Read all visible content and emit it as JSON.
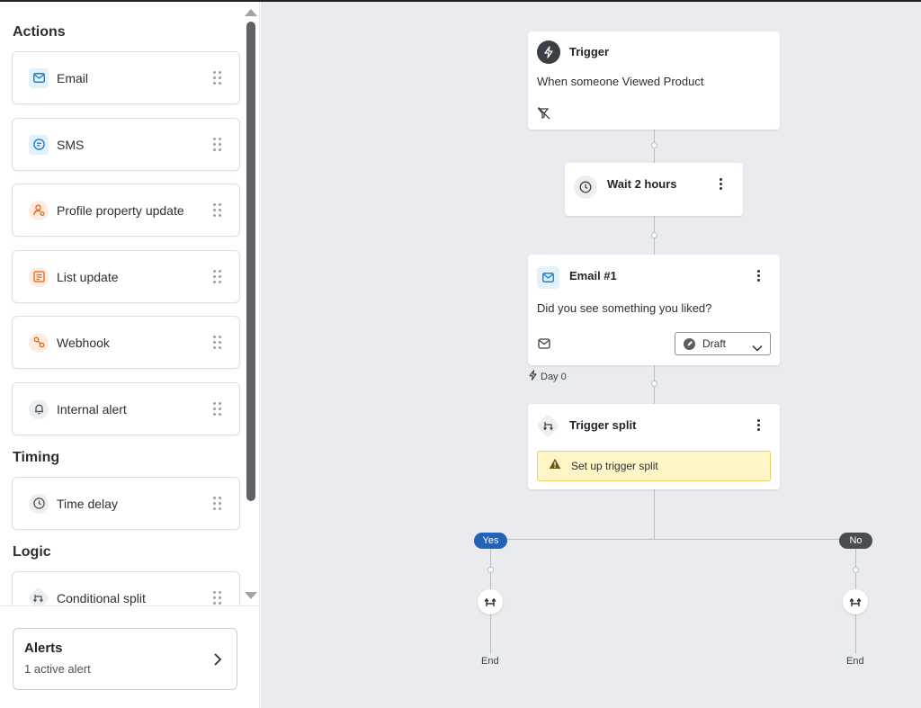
{
  "sidebar": {
    "sections": {
      "actions": "Actions",
      "timing": "Timing",
      "logic": "Logic"
    },
    "items": [
      {
        "label": "Email",
        "icon": "envelope-icon"
      },
      {
        "label": "SMS",
        "icon": "sms-icon"
      },
      {
        "label": "Profile property update",
        "icon": "profile-edit-icon"
      },
      {
        "label": "List update",
        "icon": "list-icon"
      },
      {
        "label": "Webhook",
        "icon": "webhook-icon"
      },
      {
        "label": "Internal alert",
        "icon": "bell-icon"
      },
      {
        "label": "Time delay",
        "icon": "clock-icon"
      },
      {
        "label": "Conditional split",
        "icon": "split-icon"
      }
    ],
    "alerts": {
      "title": "Alerts",
      "subtitle": "1 active alert"
    }
  },
  "flow": {
    "trigger": {
      "title": "Trigger",
      "text": "When someone Viewed Product"
    },
    "wait": {
      "title": "Wait 2 hours"
    },
    "email": {
      "title": "Email #1",
      "text": "Did you see something you liked?",
      "status": "Draft",
      "day": "Day 0"
    },
    "split": {
      "title": "Trigger split",
      "warning": "Set up trigger split"
    },
    "branches": {
      "yes": "Yes",
      "no": "No",
      "end_left": "End",
      "end_right": "End"
    }
  },
  "colors": {
    "accent_blue": "#1a7ed1",
    "yes_pill": "#2461b8",
    "no_pill": "#4a4d50",
    "warning_bg": "#fff6c7",
    "warning_border": "#e8d06a",
    "canvas_bg": "#e9ebee"
  }
}
